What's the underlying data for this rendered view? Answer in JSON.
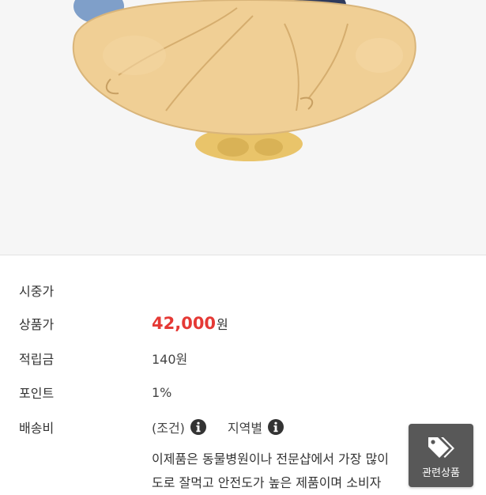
{
  "product": {
    "fields": [
      {
        "key": "list_price",
        "label": "시중가",
        "value": ""
      },
      {
        "key": "sale_price",
        "label": "상품가",
        "amount": "42,000",
        "unit": "원"
      },
      {
        "key": "reward",
        "label": "적립금",
        "value": "140원"
      },
      {
        "key": "points",
        "label": "포인트",
        "value": "1%"
      },
      {
        "key": "shipping",
        "label": "배송비",
        "condition": "(조건)",
        "region": "지역별"
      }
    ],
    "description_lines": [
      "이제품은 동물병원이나 전문샵에서 가장 많이",
      "도로 잘먹고 안전도가 높은 제품이며 소비자"
    ]
  },
  "related_button": {
    "label": "관련상품",
    "icon": "tags-icon"
  },
  "icons": {
    "info": "info-circle-icon"
  },
  "colors": {
    "price": "#e53935",
    "button_bg": "#585858",
    "image_bg": "#f6f6f6"
  }
}
